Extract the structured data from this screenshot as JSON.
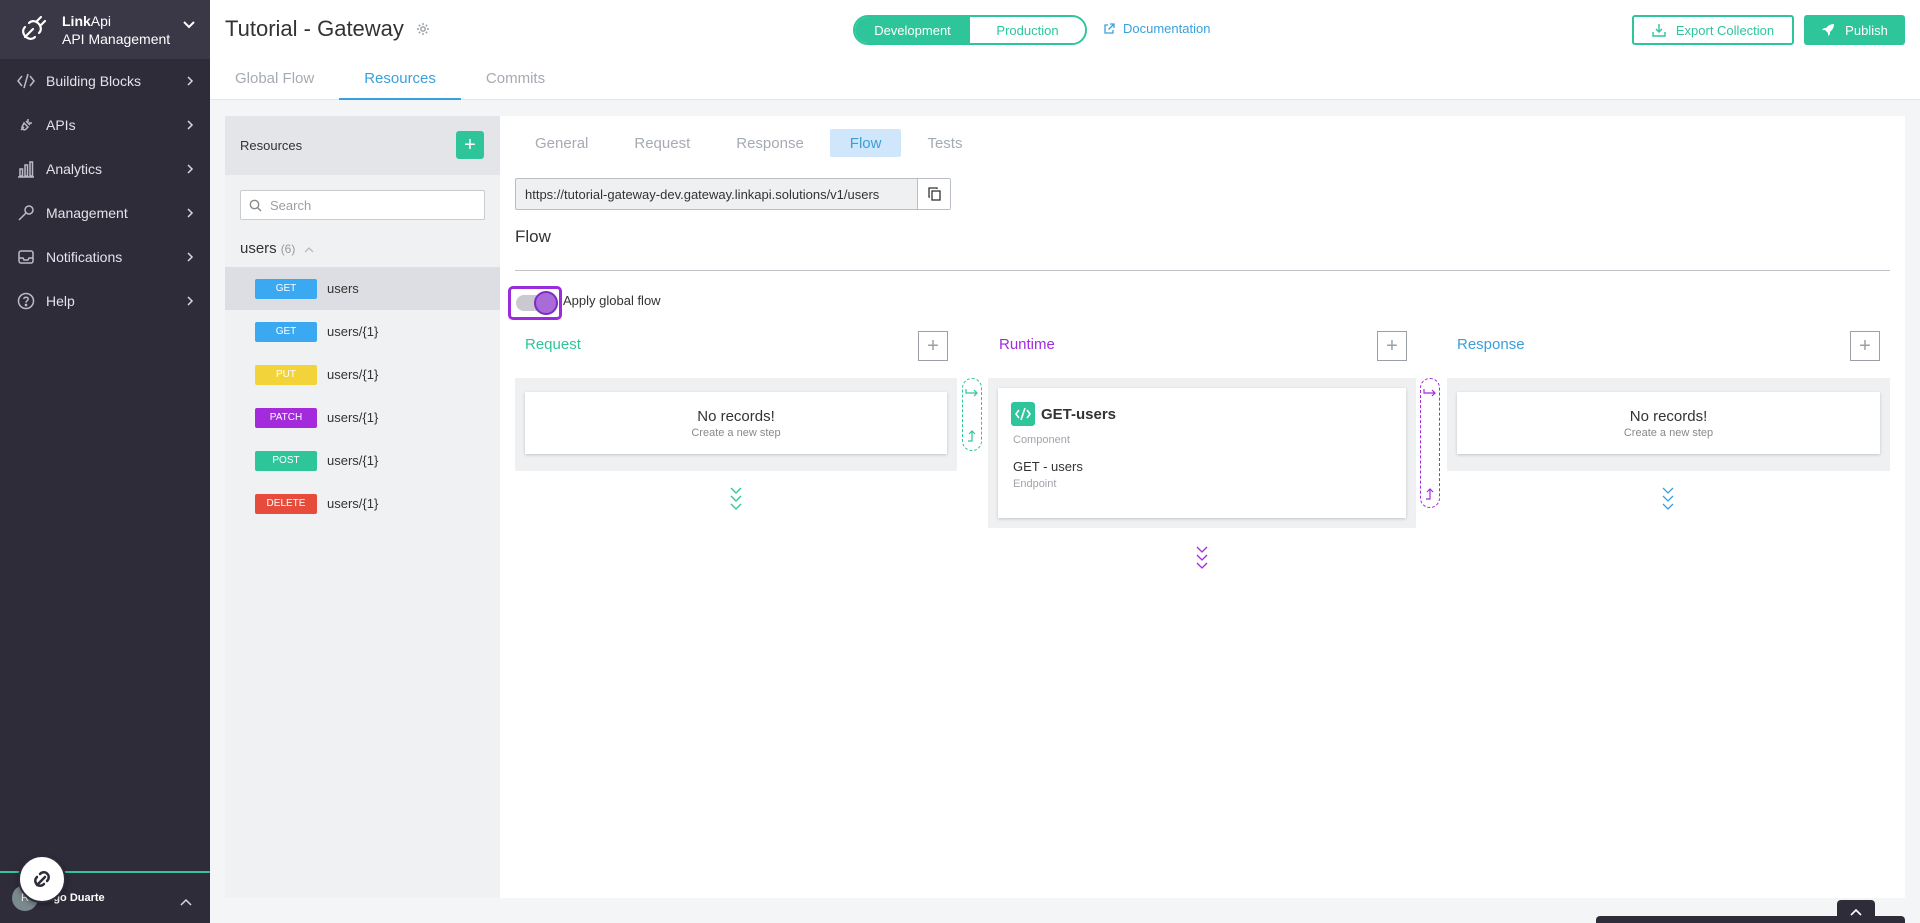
{
  "brand": {
    "name_bold": "Link",
    "name_rest": "Api",
    "subtitle": "API Management"
  },
  "sidebar": {
    "items": [
      {
        "label": "Building Blocks",
        "icon": "code-icon"
      },
      {
        "label": "APIs",
        "icon": "plug-icon"
      },
      {
        "label": "Analytics",
        "icon": "bar-chart-icon"
      },
      {
        "label": "Management",
        "icon": "wrench-icon"
      },
      {
        "label": "Notifications",
        "icon": "inbox-icon"
      },
      {
        "label": "Help",
        "icon": "question-icon"
      }
    ],
    "user": {
      "initials": "R",
      "name": "rigo Duarte"
    }
  },
  "header": {
    "title": "Tutorial - Gateway",
    "env": {
      "development": "Development",
      "production": "Production"
    },
    "documentation": "Documentation",
    "export_label": "Export Collection",
    "publish_label": "Publish",
    "tabs": [
      "Global Flow",
      "Resources",
      "Commits"
    ]
  },
  "resources": {
    "title": "Resources",
    "add_label": "+",
    "search_placeholder": "Search",
    "group": {
      "name": "users",
      "count": "(6)"
    },
    "items": [
      {
        "method": "GET",
        "path": "users",
        "color": "#3aa9f2"
      },
      {
        "method": "GET",
        "path": "users/{1}",
        "color": "#3aa9f2"
      },
      {
        "method": "PUT",
        "path": "users/{1}",
        "color": "#f2d43a"
      },
      {
        "method": "PATCH",
        "path": "users/{1}",
        "color": "#a32bdc"
      },
      {
        "method": "POST",
        "path": "users/{1}",
        "color": "#2ec59a"
      },
      {
        "method": "DELETE",
        "path": "users/{1}",
        "color": "#e64b3c"
      }
    ]
  },
  "detail": {
    "tabs": [
      "General",
      "Request",
      "Response",
      "Flow",
      "Tests"
    ],
    "url": "https://tutorial-gateway-dev.gateway.linkapi.solutions/v1/users",
    "flow_title": "Flow",
    "toggle_label": "Apply global flow",
    "columns": {
      "request": {
        "title": "Request",
        "empty_title": "No records!",
        "empty_sub": "Create a new step"
      },
      "runtime": {
        "title": "Runtime",
        "component_name": "GET-users",
        "component_type": "Component",
        "endpoint_name": "GET - users",
        "endpoint_type": "Endpoint"
      },
      "response": {
        "title": "Response",
        "empty_title": "No records!",
        "empty_sub": "Create a new step"
      }
    },
    "add_label": "+"
  },
  "colors": {
    "accent": "#2ec59a",
    "link": "#3aa0dc",
    "runtime": "#a32bdc",
    "sidebar": "#2f2c3a"
  }
}
